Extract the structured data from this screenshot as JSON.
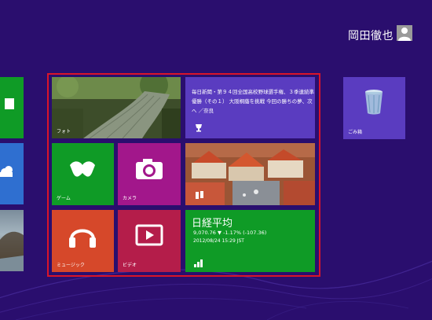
{
  "user": {
    "name": "岡田徹也",
    "avatar_icon": "user-silhouette-icon"
  },
  "start_tiles": {
    "news": {
      "text": "毎日新聞・第９４回全国高校野球選手権、３季連続準優勝（その１） 大阪桐蔭を挑戦 今回の勝ちの夢、次へ ／奈良",
      "icon": "trophy-icon"
    },
    "photos": {
      "label": "フォト"
    },
    "travel": {
      "icon": "map-icon"
    },
    "games": {
      "label": "ゲーム",
      "icon": "xbox-icon"
    },
    "camera": {
      "label": "カメラ",
      "icon": "camera-icon"
    },
    "finance": {
      "title": "日経平均",
      "value": "9,070.76 ▼ -1.17% (-107.36)",
      "date": "2012/08/24 15:29 JST",
      "icon": "chart-icon"
    },
    "music": {
      "label": "ミュージック",
      "icon": "headphones-icon"
    },
    "video": {
      "label": "ビデオ",
      "icon": "play-icon"
    },
    "recycle_bin": {
      "label": "ごみ箱",
      "icon": "recycle-bin-icon"
    }
  },
  "colors": {
    "background": "#2a0e6e",
    "tile_green": "#0f9b26",
    "tile_blue": "#2f6fd0",
    "tile_magenta": "#a2178b",
    "tile_orange": "#d6482a",
    "tile_crimson": "#b41d4a",
    "tile_purple": "#5a3cc0",
    "highlight": "#d9142a"
  }
}
